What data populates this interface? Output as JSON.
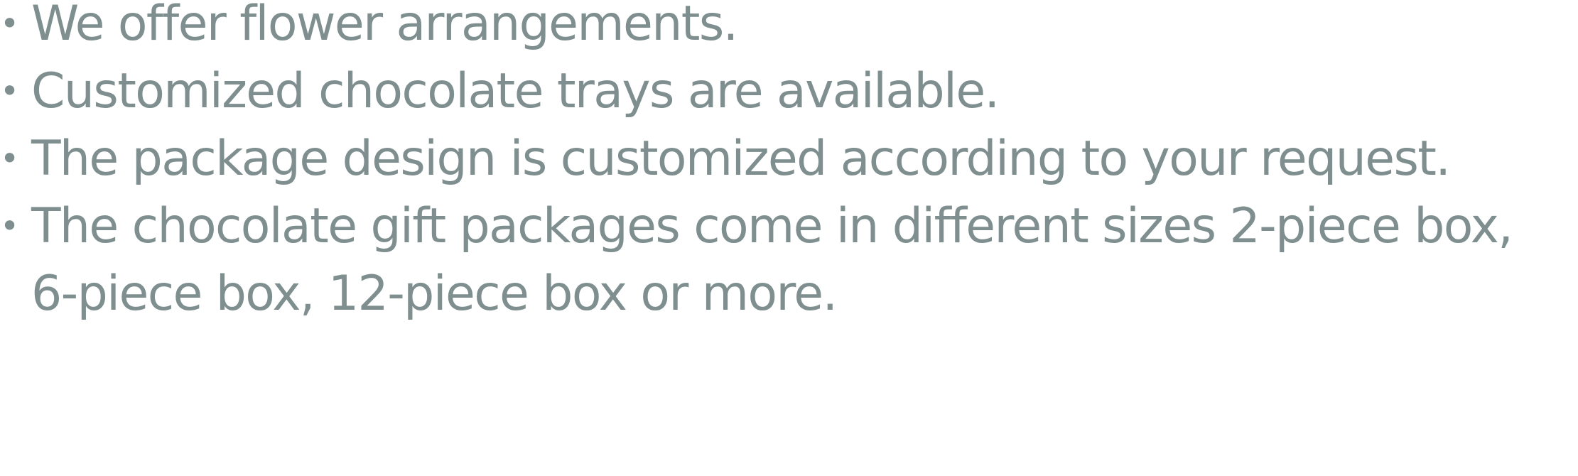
{
  "features": {
    "bullet_char": "•",
    "items": [
      {
        "lines": [
          "We offer flower arrangements."
        ]
      },
      {
        "lines": [
          "Customized chocolate trays are available."
        ]
      },
      {
        "lines": [
          "The package design is customized according to your request."
        ]
      },
      {
        "lines": [
          "The chocolate gift packages come in different sizes 2-piece box,",
          "6-piece box, 12-piece box or more."
        ]
      }
    ]
  },
  "colors": {
    "text": "#7f8f8f",
    "background": "#ffffff"
  }
}
